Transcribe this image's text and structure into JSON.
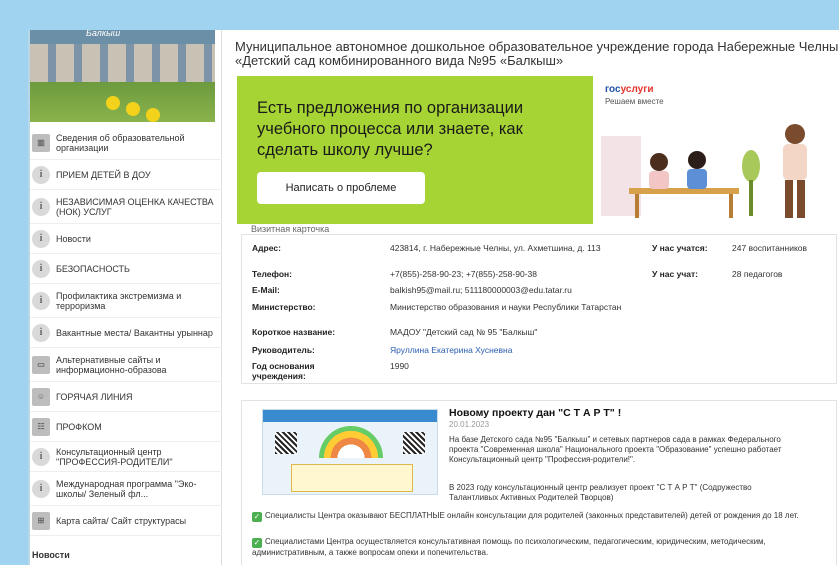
{
  "sidebar": {
    "banner_text": "Балкыш",
    "items": [
      {
        "label": "Сведения об образовательной организации",
        "icon": "building-icon"
      },
      {
        "label": "ПРИЕМ ДЕТЕЙ В ДОУ",
        "icon": "info-icon"
      },
      {
        "label": "НЕЗАВИСИМАЯ ОЦЕНКА КАЧЕСТВА (НОК) УСЛУГ",
        "icon": "info-icon"
      },
      {
        "label": "Новости",
        "icon": "info-icon"
      },
      {
        "label": "БЕЗОПАСНОСТЬ",
        "icon": "info-icon"
      },
      {
        "label": "Профилактика экстремизма и терроризма",
        "icon": "info-icon"
      },
      {
        "label": "Вакантные места/ Вакантны урыннар",
        "icon": "info-icon"
      },
      {
        "label": "Альтернативные сайты и информационно-образова",
        "icon": "monitor-icon"
      },
      {
        "label": "ГОРЯЧАЯ ЛИНИЯ",
        "icon": "people-icon"
      },
      {
        "label": "ПРОФКОМ",
        "icon": "group-icon"
      },
      {
        "label": "Консультационный центр \"ПРОФЕССИЯ-РОДИТЕЛИ\"",
        "icon": "info-icon"
      },
      {
        "label": "Международная программа \"Эко-школы/ Зеленый фл...",
        "icon": "info-icon"
      },
      {
        "label": "Карта сайта/ Сайт структурасы",
        "icon": "sitemap-icon"
      }
    ],
    "news_heading": "Новости"
  },
  "header": {
    "title": "Муниципальное автономное дошкольное образовательное учреждение города Набережные Челны «Детский сад комбинированного вида №95 «Балкыш»"
  },
  "promo": {
    "text": "Есть предложения по организации учебного процесса или знаете, как сделать школу лучше?",
    "button": "Написать о проблеме",
    "logo_part1": "гос",
    "logo_part2": "услуги",
    "logo_sub": "Решаем вместе"
  },
  "card": {
    "caption": "Визитная карточка",
    "address_label": "Адрес:",
    "address": "423814, г. Набережные Челны, ул. Ахметшина, д. 113",
    "phone_label": "Телефон:",
    "phone": "+7(855)-258-90-23; +7(855)-258-90-38",
    "email_label": "E-Mail:",
    "email": "balkish95@mail.ru; 511180000003@edu.tatar.ru",
    "ministry_label": "Министерство:",
    "ministry": "Министерство образования и науки Республики Татарстан",
    "short_label": "Короткое название:",
    "short_name": "МАДОУ \"Детский сад № 95 \"Балкыш\"",
    "head_label": "Руководитель:",
    "head": "Яруллина Екатерина Хусневна",
    "founded_label": "Год основания учреждения:",
    "founded": "1990",
    "students_label": "У нас учатся:",
    "students": "247 воспитанников",
    "teachers_label": "У нас учат:",
    "teachers": "28 педагогов"
  },
  "news": {
    "title": "Новому проекту дан \"С Т А Р Т\" !",
    "date": "20.01.2023",
    "p1": "На базе Детского сада №95 \"Балкыш\" и сетевых партнеров сада в рамках Федерального проекта \"Современная школа\" Национального проекта \"Образование\" успешно работает Консультационный центр \"Профессия-родители!\".",
    "p2": "В 2023 году консультационный центр реализует проект \"С Т А Р Т\" (Содружество Талантливых Активных Родителей Творцов)",
    "p3": "Специалисты Центра оказывают БЕСПЛАТНЫЕ онлайн консультации для родителей (законных представителей) детей от рождения до 18 лет.",
    "p4": "Специалистами Центра осуществляется консультативная помощь по психологическим, педагогическим, юридическим, методическим, административным, а также вопросам опеки и попечительства."
  }
}
